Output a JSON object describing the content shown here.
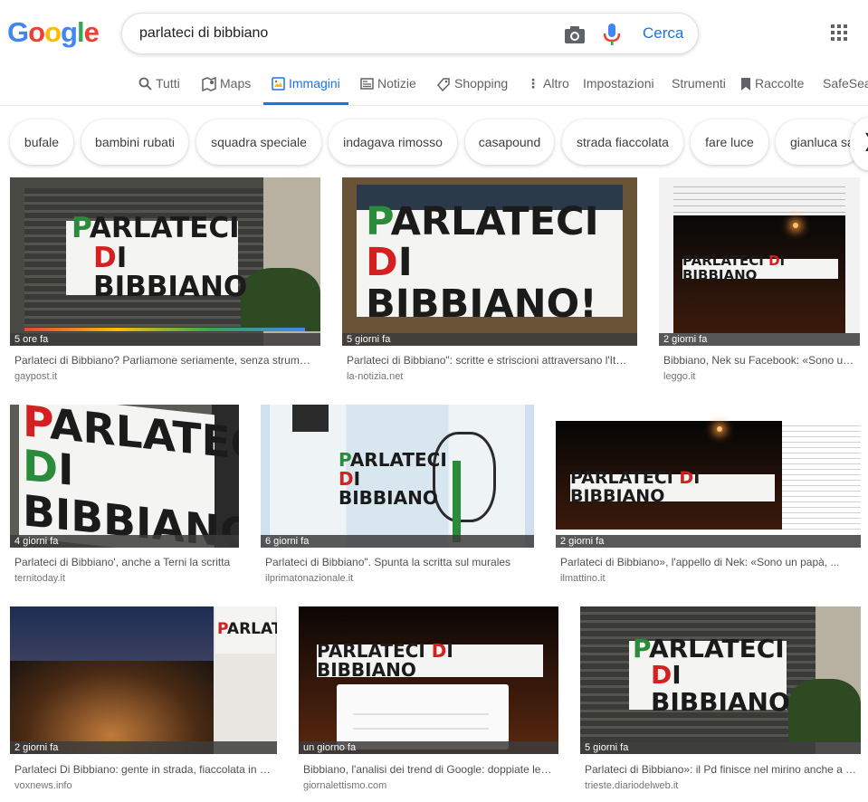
{
  "search": {
    "query": "parlateci di bibbiano",
    "submit_label": "Cerca"
  },
  "logo_text": "Google",
  "tabs": [
    {
      "label": "Tutti"
    },
    {
      "label": "Maps"
    },
    {
      "label": "Immagini"
    },
    {
      "label": "Notizie"
    },
    {
      "label": "Shopping"
    },
    {
      "label": "Altro"
    },
    {
      "label": "Impostazioni"
    },
    {
      "label": "Strumenti"
    },
    {
      "label": "Raccolte"
    },
    {
      "label": "SafeSear"
    }
  ],
  "chips": [
    "bufale",
    "bambini rubati",
    "squadra speciale",
    "indagava rimosso",
    "casapound",
    "strada fiaccolata",
    "fare luce",
    "gianluca sa"
  ],
  "colors": {
    "accent": "#1a73e8",
    "banner_green": "#2a8b3a",
    "banner_red": "#d42020"
  },
  "banner": {
    "l1": "PARLATECI",
    "l1a": "P",
    "l1b": "ARLATECI",
    "l2a": "D",
    "l2b": "I BIBBIANO",
    "l2c": "I BIBBIANO!",
    "one_line_a": "PARLATECI ",
    "one_line_b": "D",
    "one_line_c": "I BIBBIANO"
  },
  "results": [
    {
      "time": "5 ore fa",
      "title": "Parlateci di Bibbiano? Parliamone seriamente, senza strumentalizzazioni",
      "source": "gaypost.it"
    },
    {
      "time": "5 giorni fa",
      "title": "Parlateci di Bibbiano\": scritte e striscioni attraversano l'Italia",
      "source": "la-notizia.net"
    },
    {
      "time": "2 giorni fa",
      "title": "Bibbiano, Nek su Facebook: «Sono un papà»",
      "source": "leggo.it"
    },
    {
      "time": "4 giorni fa",
      "title": "Parlateci di Bibbiano', anche a Terni la scritta",
      "source": "ternitoday.it"
    },
    {
      "time": "6 giorni fa",
      "title": "Parlateci di Bibbiano\". Spunta la scritta sul murales",
      "source": "ilprimatonazionale.it"
    },
    {
      "time": "2 giorni fa",
      "title": "Parlateci di Bibbiano», l'appello di Nek: «Sono un papà, ...",
      "source": "ilmattino.it"
    },
    {
      "time": "2 giorni fa",
      "title": "Parlateci Di Bibbiano: gente in strada, fiaccolata in città",
      "source": "voxnews.info"
    },
    {
      "time": "un giorno fa",
      "title": "Bibbiano, l'analisi dei trend di Google: doppiate le ricerche",
      "source": "giornalettismo.com"
    },
    {
      "time": "5 giorni fa",
      "title": "Parlateci di Bibbiano»: il Pd finisce nel mirino anche a Trieste",
      "source": "trieste.diariodelweb.it"
    }
  ]
}
